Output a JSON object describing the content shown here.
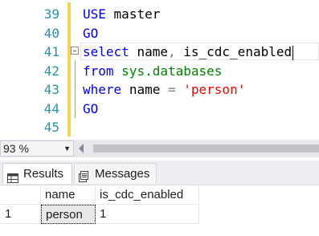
{
  "editor": {
    "lines": [
      {
        "num": "39",
        "text": "USE master"
      },
      {
        "num": "40",
        "text": "GO"
      },
      {
        "num": "41",
        "text": "select name, is_cdc_enabled"
      },
      {
        "num": "42",
        "text": "from sys.databases"
      },
      {
        "num": "43",
        "text": "where name = 'person'"
      },
      {
        "num": "44",
        "text": "GO"
      },
      {
        "num": "45",
        "text": ""
      }
    ],
    "tokens": {
      "use": "USE",
      "master": "master",
      "go": "GO",
      "select": "select",
      "name": "name",
      "comma": ",",
      "is_cdc_enabled": "is_cdc_enabled",
      "from": "from",
      "sys_databases": "sys.databases",
      "where": "where",
      "eq": "=",
      "person_str": "'person'"
    }
  },
  "zoom": {
    "value": "93 %"
  },
  "tabs": {
    "results": "Results",
    "messages": "Messages"
  },
  "grid": {
    "columns": [
      "name",
      "is_cdc_enabled"
    ],
    "rows": [
      {
        "rownum": "1",
        "name": "person",
        "is_cdc_enabled": "1"
      }
    ]
  },
  "colors": {
    "keyword": "#0000ff",
    "line_number": "#2b91af",
    "string": "#ff0000",
    "system_object": "#008000",
    "change_marker": "#f2d64b"
  }
}
